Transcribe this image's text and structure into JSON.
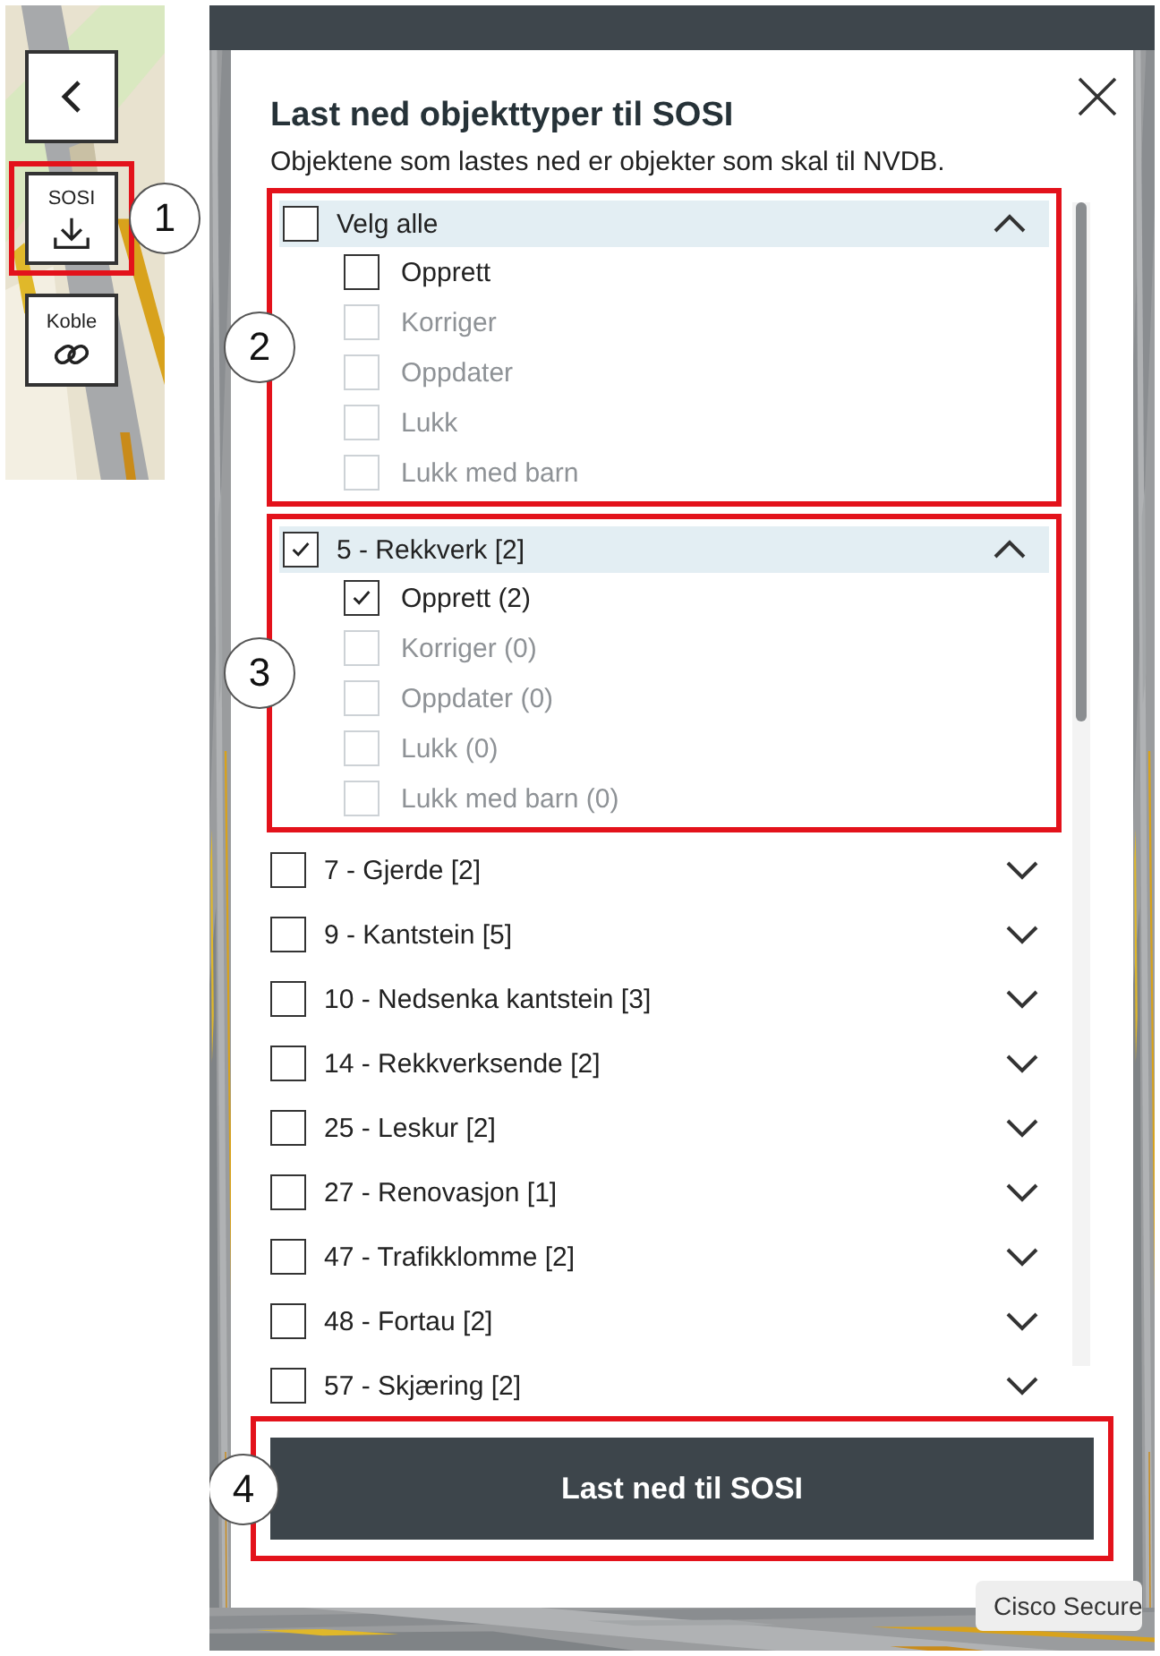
{
  "toolbar": {
    "buttons": [
      {
        "kind": "back"
      },
      {
        "kind": "download",
        "label": "SOSI",
        "annotation": "1"
      },
      {
        "kind": "link",
        "label": "Koble"
      }
    ]
  },
  "dialog": {
    "title": "Last ned objekttyper til SOSI",
    "subtitle": "Objektene som lastes ned er objekter som skal til NVDB.",
    "groups": [
      {
        "label": "Velg alle",
        "checked": false,
        "expanded": true,
        "annotation": "2",
        "children": [
          {
            "label": "Opprett",
            "checked": false,
            "disabled": false
          },
          {
            "label": "Korriger",
            "checked": false,
            "disabled": true
          },
          {
            "label": "Oppdater",
            "checked": false,
            "disabled": true
          },
          {
            "label": "Lukk",
            "checked": false,
            "disabled": true
          },
          {
            "label": "Lukk med barn",
            "checked": false,
            "disabled": true
          }
        ]
      },
      {
        "label": "5 - Rekkverk [2]",
        "checked": true,
        "expanded": true,
        "annotation": "3",
        "children": [
          {
            "label": "Opprett (2)",
            "checked": true,
            "disabled": false
          },
          {
            "label": "Korriger (0)",
            "checked": false,
            "disabled": true
          },
          {
            "label": "Oppdater (0)",
            "checked": false,
            "disabled": true
          },
          {
            "label": "Lukk (0)",
            "checked": false,
            "disabled": true
          },
          {
            "label": "Lukk med barn (0)",
            "checked": false,
            "disabled": true
          }
        ]
      },
      {
        "label": "7 - Gjerde [2]",
        "checked": false,
        "expanded": false
      },
      {
        "label": "9 - Kantstein [5]",
        "checked": false,
        "expanded": false
      },
      {
        "label": "10 - Nedsenka kantstein [3]",
        "checked": false,
        "expanded": false
      },
      {
        "label": "14 - Rekkverksende [2]",
        "checked": false,
        "expanded": false
      },
      {
        "label": "25 - Leskur [2]",
        "checked": false,
        "expanded": false
      },
      {
        "label": "27 - Renovasjon [1]",
        "checked": false,
        "expanded": false
      },
      {
        "label": "47 - Trafikklomme [2]",
        "checked": false,
        "expanded": false
      },
      {
        "label": "48 - Fortau [2]",
        "checked": false,
        "expanded": false
      },
      {
        "label": "57 - Skjæring [2]",
        "checked": false,
        "expanded": false
      }
    ],
    "button": {
      "label": "Last ned til SOSI",
      "annotation": "4"
    }
  },
  "tooltip": {
    "text": "Cisco Secure"
  }
}
